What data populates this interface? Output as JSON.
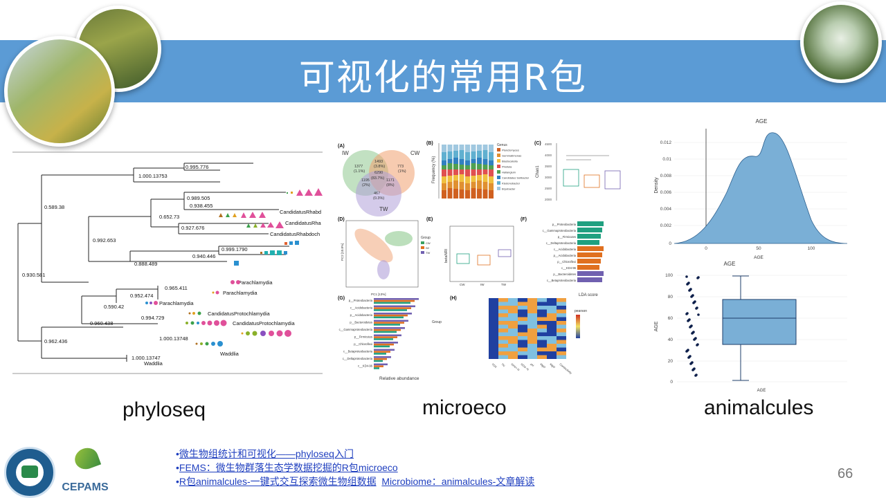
{
  "slide": {
    "title": "可视化的常用R包",
    "page_number": "66"
  },
  "packages": {
    "phyloseq": "phyloseq",
    "microeco": "microeco",
    "animalcules": "animalcules"
  },
  "links": [
    {
      "bullet": "•",
      "text": "微生物组统计和可视化——phyloseq入门"
    },
    {
      "bullet": "•",
      "text": "FEMS：微生物群落生态学数据挖掘的R包microeco"
    },
    {
      "bullet": "•",
      "text": "R包animalcules-一键式交互探索微生物组数据",
      "text2": "Microbiome：animalcules-文章解读"
    }
  ],
  "logos": {
    "cepams": "CEPAMS"
  },
  "tree": {
    "labels": [
      "0.995.776",
      "1.000.13753",
      "0.989.505",
      "0.938.455",
      "0.652.73",
      "0.927.676",
      "0.589.38",
      "0.999.1790",
      "0.940.446",
      "0.992.653",
      "0.888.489",
      "0.930.581",
      "0.965.411",
      "0.952.474",
      "0.590.42",
      "0.994.729",
      "0.960.438",
      "1.000.13748",
      "0.962.436",
      "1.000.13747"
    ],
    "taxa": [
      "CandidatusRhabd",
      "CandidatusRha",
      "CandidatusRhabdoch",
      "Parachlamydia",
      "Parachlamydia",
      "Parachlamydia",
      "CandidatusProtochlamydia",
      "CandidatusProtochlamydia",
      "Waddlia",
      "Waddlia"
    ]
  },
  "microeco": {
    "panels": [
      "(A)",
      "(B)",
      "(C)",
      "(D)",
      "(E)",
      "(F)",
      "(G)",
      "(H)"
    ],
    "venn": {
      "sets": [
        "IW",
        "CW",
        "TW"
      ],
      "values": [
        "1377",
        "(1.1%)",
        "1493",
        "(3.8%)",
        "773",
        "(1%)",
        "6290",
        "(83.7%)",
        "1195",
        "1171",
        "(2%)",
        "(8%)",
        "467",
        "(0.3%)"
      ]
    },
    "bar_ylabel": "Frequency (%)",
    "genus_title": "Genus",
    "genus": [
      "Planctomyces",
      "Gemmatimonas",
      "Blastocatella",
      "Pirellula",
      "Haliangium",
      "Candidatus Solibacter",
      "Ktedonobacter",
      "Bryobacter"
    ],
    "chao_label": "Chao1",
    "chao_ticks": [
      "4500",
      "4000",
      "3500",
      "3000",
      "2500",
      "2000"
    ],
    "pc_labels": [
      "PC1 [13%]",
      "PC2 [10.8%]"
    ],
    "group_title": "Group",
    "groups": [
      "CW",
      "IW",
      "TW"
    ],
    "beta_label": "betaNRI",
    "lda_taxa": [
      "p__Proteobacteria",
      "c__Gammaproteobacteria",
      "p__Firmicutes",
      "c__Deltaproteobacteria",
      "c__Acidobacteria",
      "p__Acidobacteria",
      "p__Chloroflexi",
      "c__KD4-96",
      "p__Bacteroidetes",
      "c__Betaproteobacteria"
    ],
    "lda_label": "LDA score",
    "rel_taxa": [
      "p__Proteobacteria",
      "c__Acidobacteria",
      "p__Acidobacteria",
      "p__Bacteroidetes",
      "c__Gammaproteobacteria",
      "p__Firmicutes",
      "p__Chloroflexi",
      "c__Betaproteobacteria",
      "c__Deltaproteobacteria",
      "c__KD4-96"
    ],
    "rel_label": "Relative abundance",
    "heat_x": [
      "TOC",
      "TN",
      "NH4+-N",
      "NO3--N",
      "pH",
      "MgO",
      "MgO",
      "Conductivity"
    ],
    "heat_legend": "pearson"
  },
  "animalcules": {
    "density_title": "AGE",
    "density_ylabel": "Density",
    "density_xlabel": "AGE",
    "density_yticks": [
      "0.012",
      "0.01",
      "0.008",
      "0.006",
      "0.004",
      "0.002",
      "0"
    ],
    "density_xticks": [
      "0",
      "50",
      "100"
    ],
    "box_title": "AGE",
    "box_ylabel": "AGE",
    "box_xlabel": "AGE",
    "box_yticks": [
      "100",
      "80",
      "60",
      "40",
      "20",
      "0"
    ]
  }
}
